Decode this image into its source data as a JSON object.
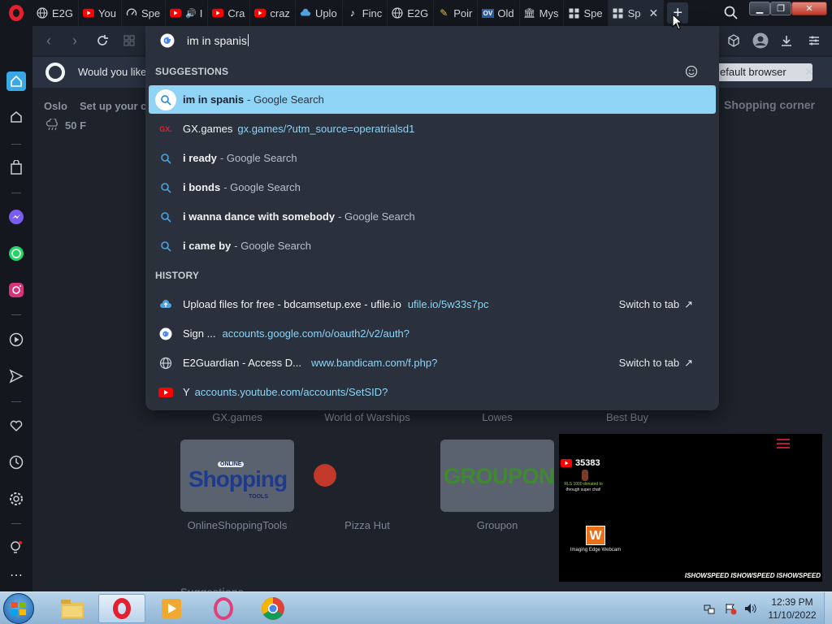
{
  "tabs": [
    {
      "icon": "globe-icon",
      "label": "E2G"
    },
    {
      "icon": "youtube-icon",
      "label": "You"
    },
    {
      "icon": "speedometer-icon",
      "label": "Spe"
    },
    {
      "icon": "youtube-icon",
      "label": "I"
    },
    {
      "icon": "youtube-icon",
      "label": "Cra"
    },
    {
      "icon": "youtube-icon",
      "label": "craz"
    },
    {
      "icon": "cloud-upload-icon",
      "label": "Uplo"
    },
    {
      "icon": "tiktok-icon",
      "label": "Finc"
    },
    {
      "icon": "globe-icon",
      "label": "E2G"
    },
    {
      "icon": "pencil-icon",
      "label": "Poir"
    },
    {
      "icon": "ov-icon",
      "label": "Old"
    },
    {
      "icon": "museum-icon",
      "label": "Mys"
    },
    {
      "icon": "grid-icon",
      "label": "Spe"
    },
    {
      "icon": "grid-icon",
      "label": "Sp",
      "active": true
    }
  ],
  "address": {
    "query": "im in spanis"
  },
  "notification": {
    "text": "Would you like t",
    "button": "efault browser"
  },
  "speed_dial": {
    "city": "Oslo",
    "setup": "Set up your ci",
    "temperature": "50 F",
    "shopping_corner": "Shopping corner",
    "row1_labels": [
      "GX.games",
      "World of Warships",
      "Lowes",
      "Best Buy"
    ],
    "row2_labels": [
      "OnlineShoppingTools",
      "Pizza Hut",
      "Groupon"
    ],
    "suggestions": "Suggestions",
    "logos": {
      "shopping_top": "ONLINE",
      "shopping_main": "Shopping",
      "shopping_bottom": "TOOLS",
      "groupon": "GROUPON"
    }
  },
  "dropdown": {
    "suggestions_header": "SUGGESTIONS",
    "history_header": "HISTORY",
    "suggestions": [
      {
        "main": "im in spanis",
        "sub": "- Google Search",
        "highlighted": true
      },
      {
        "main": "GX.games",
        "url": "gx.games/?utm_source=operatrialsd1"
      },
      {
        "main": "i ready",
        "sub": "- Google Search"
      },
      {
        "main": "i bonds",
        "sub": "- Google Search"
      },
      {
        "main": "i wanna dance with somebody",
        "sub": "- Google Search"
      },
      {
        "main": "i came by",
        "sub": "- Google Search"
      }
    ],
    "history": [
      {
        "main": "Upload files for free - bdcamsetup.exe - ufile.io",
        "url": "ufile.io/5w33s7pc",
        "action": "Switch to tab"
      },
      {
        "main": "Sign ...",
        "url": "accounts.google.com/o/oauth2/v2/auth?"
      },
      {
        "main": "E2Guardian - Access D...",
        "url": "www.bandicam.com/f.php?",
        "action": "Switch to tab"
      },
      {
        "main": "Y",
        "url": "accounts.youtube.com/accounts/SetSID?"
      }
    ]
  },
  "webcam": {
    "subs": "35383",
    "donation_line1": "RLS 1000 donated to",
    "donation_line2": "through super chat!",
    "watermark_logo": "W",
    "watermark": "Imaging Edge Webcam",
    "footer": "ISHOWSPEED ISHOWSPEED ISHOWSPEED"
  },
  "taskbar": {
    "time": "12:39 PM",
    "date": "11/10/2022"
  },
  "colors": {
    "opera_red": "#e5202e",
    "highlight": "#8fd3f5",
    "youtube_red": "#ff0000"
  }
}
